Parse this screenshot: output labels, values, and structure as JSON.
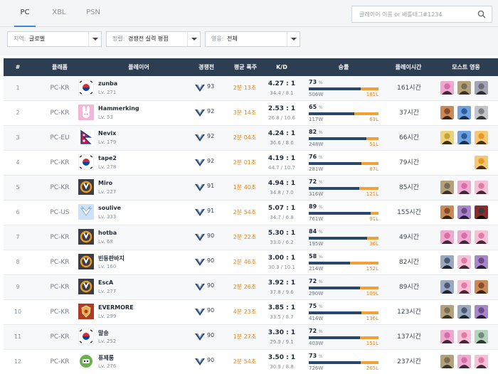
{
  "tabs": [
    {
      "label": "PC",
      "active": true
    },
    {
      "label": "XBL",
      "active": false
    },
    {
      "label": "PSN",
      "active": false
    }
  ],
  "search": {
    "placeholder": "클레이어 이름 or 배틀태그#1234"
  },
  "filters": [
    {
      "label": "지역:",
      "value": "글로벌"
    },
    {
      "label": "정렬:",
      "value": "경쟁전 실력 평점"
    },
    {
      "label": "영웅:",
      "value": "전체"
    }
  ],
  "columns": {
    "rank": "#",
    "platform": "플래폼",
    "player": "플레이어",
    "competitive": "경쟁전",
    "avg_fire": "평균 폭주",
    "kd": "K/D",
    "winrate": "승률",
    "playtime": "플레이시간",
    "most_heroes": "모스트 영웅"
  },
  "colors": {
    "header_bg": "#2e3e52",
    "win_bar": "#27476c",
    "loss_bar": "#f2a035",
    "accent": "#3a89d8",
    "orange_text": "#e2851e"
  },
  "rows": [
    {
      "rank": "1",
      "platform": "PC-KR",
      "icon": "korea-flag-icon",
      "name": "zunba",
      "level": "Lv. 271",
      "cr": "93",
      "avg": "2분 13초",
      "kd": "4.27 : 1",
      "kd_detail": "34.4 / 8.1",
      "winrate_pct": "73",
      "winrate_unit": "%",
      "win_fraction": 0.74,
      "wins": "506W",
      "losses": "181L",
      "playtime": "161시간",
      "heroes": [
        "zarya-icon",
        "roadhog-icon",
        "winston-icon"
      ]
    },
    {
      "rank": "2",
      "platform": "PC-KR",
      "icon": "dva-bunny-icon",
      "name": "Hammerking",
      "level": "Lv. 53",
      "cr": "92",
      "avg": "3분 14초",
      "kd": "2.53 : 1",
      "kd_detail": "26.8 / 10.6",
      "winrate_pct": "65",
      "winrate_unit": "%",
      "win_fraction": 0.65,
      "wins": "117W",
      "losses": "63L",
      "playtime": "37시간",
      "heroes": [
        "mccree-icon",
        "pharah-icon",
        "reinhardt-icon"
      ]
    },
    {
      "rank": "3",
      "platform": "PC-EU",
      "icon": "nepal-flag-icon",
      "name": "Nevix",
      "level": "Lv. 179",
      "cr": "92",
      "avg": "2분 04초",
      "kd": "4.24 : 1",
      "kd_detail": "36.6 / 8.6",
      "winrate_pct": "82",
      "winrate_unit": "%",
      "win_fraction": 0.83,
      "wins": "248W",
      "losses": "51L",
      "playtime": "66시간",
      "heroes": [
        "zenyatta-icon",
        "pharah-icon",
        "tracer-icon"
      ]
    },
    {
      "rank": "4",
      "platform": "PC-KR",
      "icon": "korea-flag-icon",
      "name": "tape2",
      "level": "Lv. 278",
      "cr": "92",
      "avg": "2분 01초",
      "kd": "4.19 : 1",
      "kd_detail": "44.7 / 10.7",
      "winrate_pct": "76",
      "winrate_unit": "%",
      "win_fraction": 0.76,
      "wins": "281W",
      "losses": "87L",
      "playtime": "79시간",
      "heroes": [
        "tracer-icon"
      ]
    },
    {
      "rank": "5",
      "platform": "PC-KR",
      "icon": "overwatch-logo-icon",
      "name": "Miro",
      "level": "Lv. 227",
      "cr": "91",
      "avg": "1분 40초",
      "kd": "4.94 : 1",
      "kd_detail": "34.8 / 7.0",
      "winrate_pct": "72",
      "winrate_unit": "%",
      "win_fraction": 0.72,
      "wins": "316W",
      "losses": "121L",
      "playtime": "85시간",
      "heroes": [
        "roadhog-icon",
        "zarya-icon",
        "dva-icon"
      ]
    },
    {
      "rank": "6",
      "platform": "PC-US",
      "icon": "mercy-wings-icon",
      "name": "soulive",
      "level": "Lv. 333",
      "cr": "91",
      "avg": "2분 54초",
      "kd": "5.07 : 1",
      "kd_detail": "34.7 / 6.8",
      "winrate_pct": "89",
      "winrate_unit": "%",
      "win_fraction": 0.89,
      "wins": "761W",
      "losses": "91L",
      "playtime": "155시간",
      "heroes": [
        "mccree-icon",
        "widowmaker-icon",
        "reaper-icon"
      ]
    },
    {
      "rank": "7",
      "platform": "PC-KR",
      "icon": "overwatch-logo-icon",
      "name": "hotba",
      "level": "Lv. 68",
      "cr": "90",
      "avg": "2분 22초",
      "kd": "5.30 : 1",
      "kd_detail": "33.0 / 6.2",
      "winrate_pct": "84",
      "winrate_unit": "%",
      "win_fraction": 0.84,
      "wins": "195W",
      "losses": "36L",
      "playtime": "49시간",
      "heroes": [
        "zarya-icon",
        "zarya-icon",
        "dva-icon"
      ]
    },
    {
      "rank": "8",
      "platform": "PC-KR",
      "icon": "overwatch-logo-icon",
      "name": "빈둥판바지",
      "level": "Lv. 160",
      "cr": "90",
      "avg": "2분 46초",
      "kd": "3.00 : 1",
      "kd_detail": "30.3 / 10.1",
      "winrate_pct": "58",
      "winrate_unit": "%",
      "win_fraction": 0.59,
      "wins": "214W",
      "losses": "152L",
      "playtime": "82시간",
      "heroes": [
        "soldier76-icon",
        "dva-icon",
        "widowmaker-icon"
      ]
    },
    {
      "rank": "9",
      "platform": "PC-KR",
      "icon": "overwatch-logo-icon",
      "name": "EscA",
      "level": "Lv. 277",
      "cr": "90",
      "avg": "2분 26초",
      "kd": "3.92 : 1",
      "kd_detail": "37.8 / 9.6",
      "winrate_pct": "72",
      "winrate_unit": "%",
      "win_fraction": 0.73,
      "wins": "290W",
      "losses": "109L",
      "playtime": "89시간",
      "heroes": [
        "soldier76-icon",
        "dva-icon",
        "mccree-icon"
      ]
    },
    {
      "rank": "10",
      "platform": "PC-KR",
      "icon": "gold-crest-icon",
      "name": "EVERMORE",
      "level": "Lv. 299",
      "cr": "90",
      "avg": "4분 23초",
      "kd": "3.85 : 1",
      "kd_detail": "33.5 / 8.7",
      "winrate_pct": "75",
      "winrate_unit": "%",
      "win_fraction": 0.75,
      "wins": "414W",
      "losses": "136L",
      "playtime": "123시간",
      "heroes": [
        "roadhog-icon",
        "soldier76-icon",
        "widowmaker-icon"
      ]
    },
    {
      "rank": "11",
      "platform": "PC-KR",
      "icon": "korea-flag-icon",
      "name": "말숑",
      "level": "Lv. 252",
      "cr": "90",
      "avg": "1분 27초",
      "kd": "3.30 : 1",
      "kd_detail": "29.9 / 9.1",
      "winrate_pct": "72",
      "winrate_unit": "%",
      "win_fraction": 0.73,
      "wins": "403W",
      "losses": "151L",
      "playtime": "137시간",
      "heroes": [
        "zarya-icon",
        "dva-icon",
        "genji-icon"
      ]
    },
    {
      "rank": "12",
      "platform": "PC-KR",
      "icon": "green-robot-icon",
      "name": "퓨제롱",
      "level": "Lv. 276",
      "cr": "90",
      "avg": "2분 54초",
      "kd": "3.50 : 1",
      "kd_detail": "30.9 / 8.8",
      "winrate_pct": "73",
      "winrate_unit": "%",
      "win_fraction": 0.74,
      "wins": "726W",
      "losses": "265L",
      "playtime": "237시간",
      "heroes": [
        "roadhog-icon",
        "zarya-icon",
        "dva-icon"
      ]
    }
  ]
}
